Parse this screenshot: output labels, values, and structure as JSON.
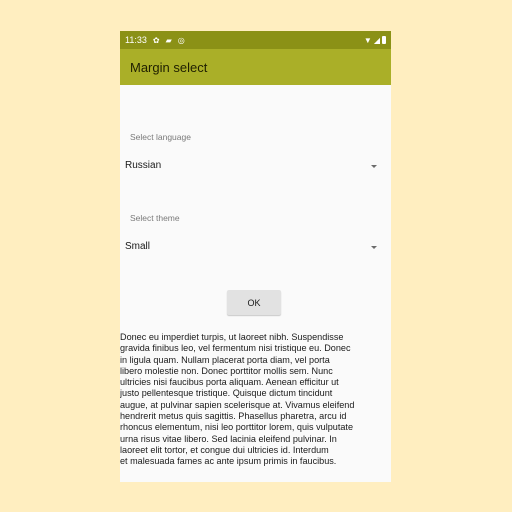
{
  "status_bar": {
    "time": "11:33",
    "left_icons": [
      "settings-icon",
      "sd-card-icon",
      "sync-icon"
    ],
    "right_icons": [
      "wifi-icon",
      "signal-icon",
      "battery-icon"
    ]
  },
  "app_bar": {
    "title": "Margin select"
  },
  "language": {
    "label": "Select language",
    "value": "Russian"
  },
  "theme": {
    "label": "Select theme",
    "value": "Small"
  },
  "ok_button": {
    "label": "OK"
  },
  "body_text": "Donec eu imperdiet turpis, ut laoreet nibh. Suspendisse\ngravida finibus leo, vel fermentum nisi tristique eu. Donec\nin ligula quam. Nullam placerat porta diam, vel porta\nlibero molestie non. Donec porttitor mollis sem. Nunc\nultricies nisi faucibus porta aliquam. Aenean efficitur ut\njusto pellentesque tristique. Quisque dictum tincidunt\naugue, at pulvinar sapien scelerisque at. Vivamus eleifend\nhendrerit metus quis sagittis. Phasellus pharetra, arcu id\nrhoncus elementum, nisi leo porttitor lorem, quis vulputate\nurna risus vitae libero. Sed lacinia eleifend pulvinar. In\nlaoreet elit tortor, et congue dui ultricies id. Interdum\net malesuada fames ac ante ipsum primis in faucibus.",
  "colors": {
    "status_bar": "#8b9116",
    "app_bar": "#aaaf28",
    "background": "#ffeec0"
  }
}
